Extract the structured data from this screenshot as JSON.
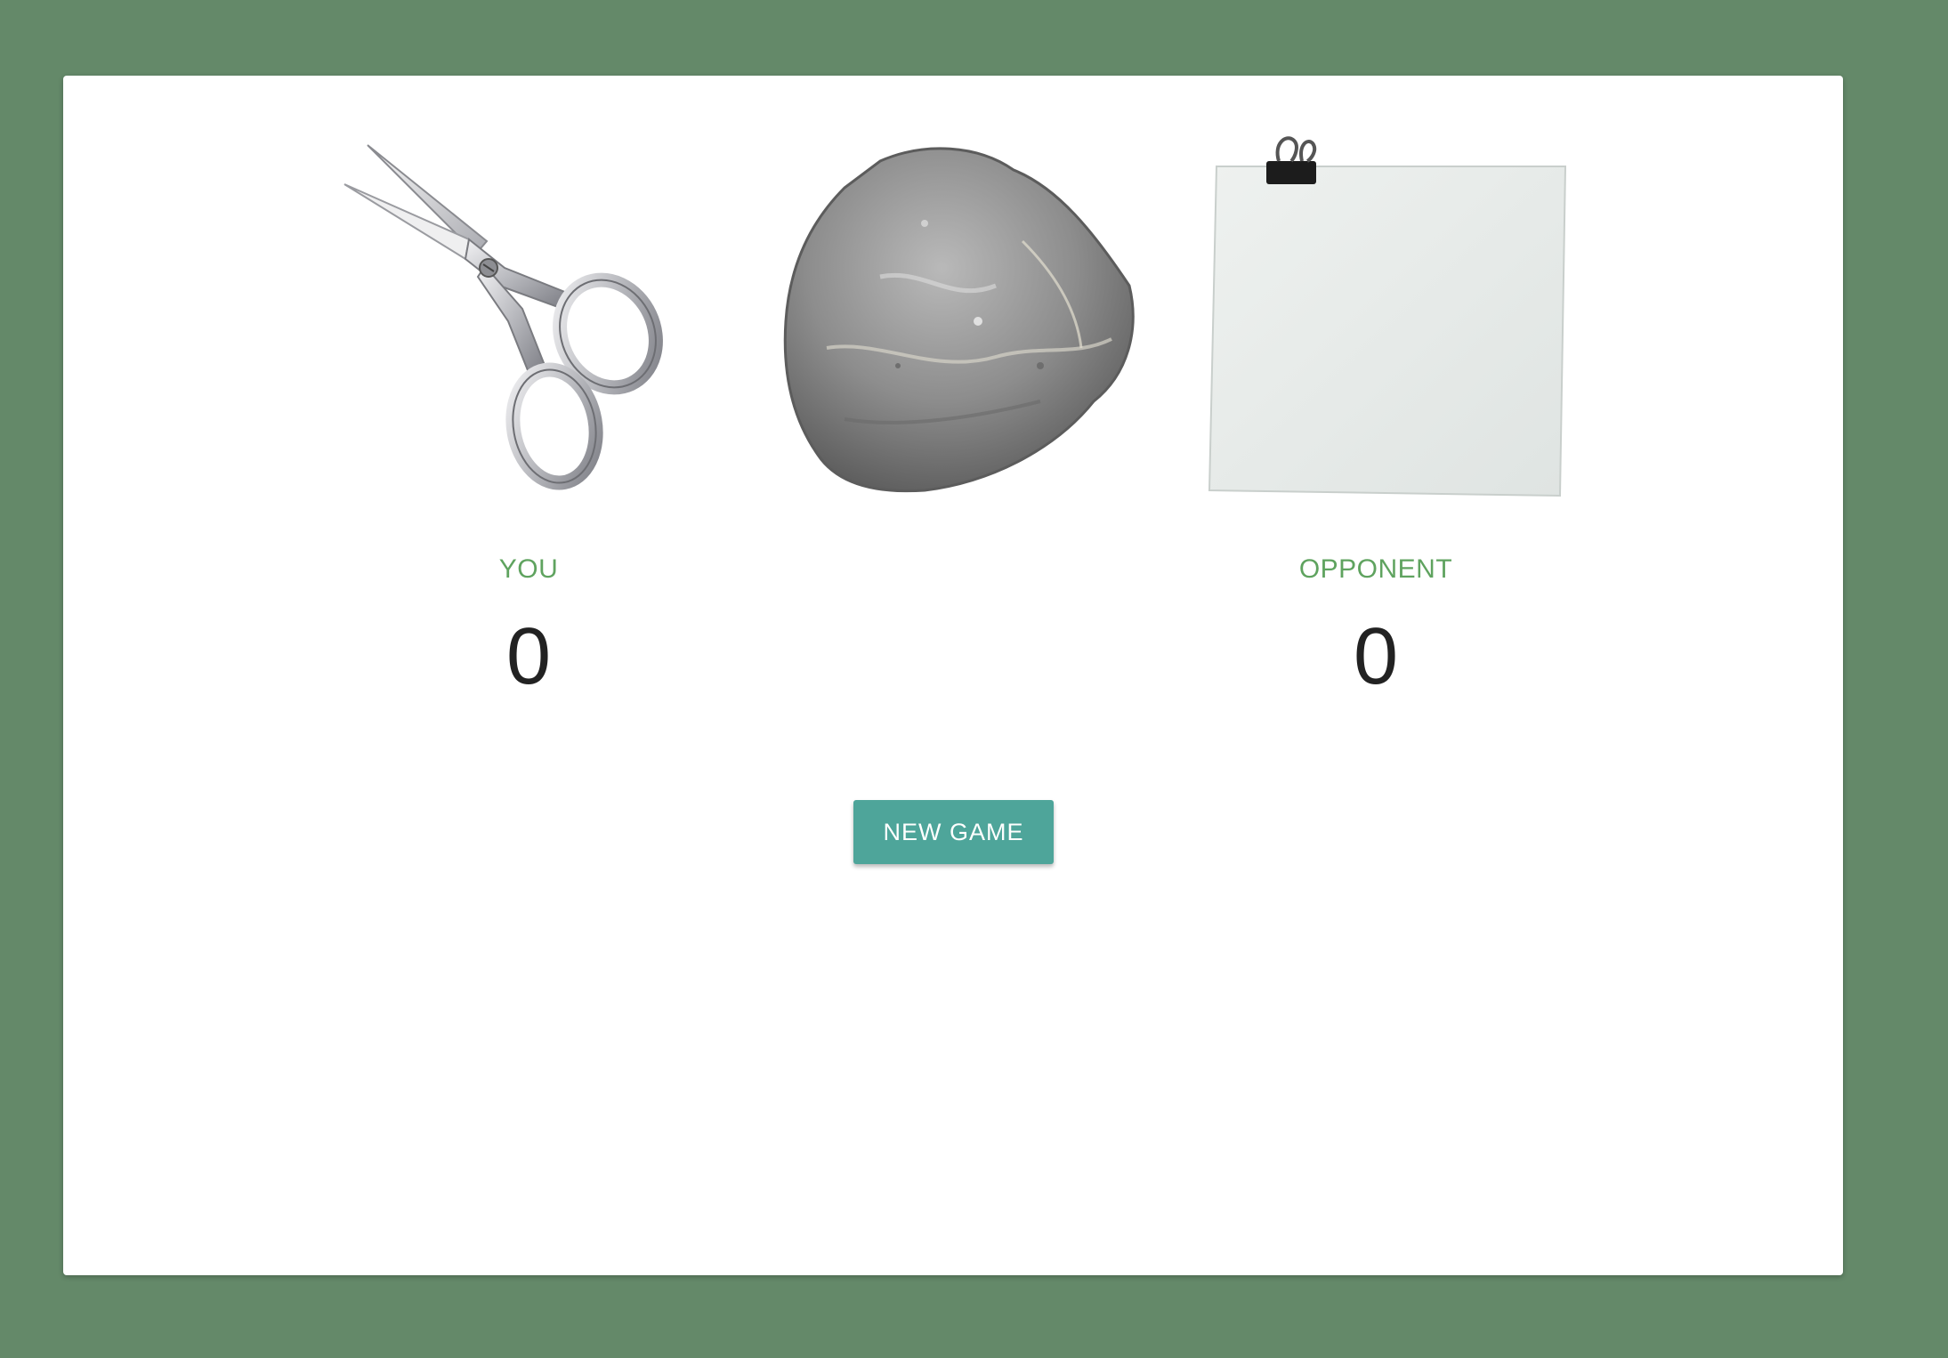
{
  "choices": [
    {
      "id": "scissors",
      "name": "scissors-icon"
    },
    {
      "id": "rock",
      "name": "rock-icon"
    },
    {
      "id": "paper",
      "name": "paper-icon"
    }
  ],
  "scores": {
    "you": {
      "label": "YOU",
      "value": "0"
    },
    "opponent": {
      "label": "OPPONENT",
      "value": "0"
    }
  },
  "new_game": {
    "label": "NEW GAME"
  },
  "colors": {
    "background": "#648969",
    "label_green": "#5fa35f",
    "button": "#4ea59a"
  }
}
